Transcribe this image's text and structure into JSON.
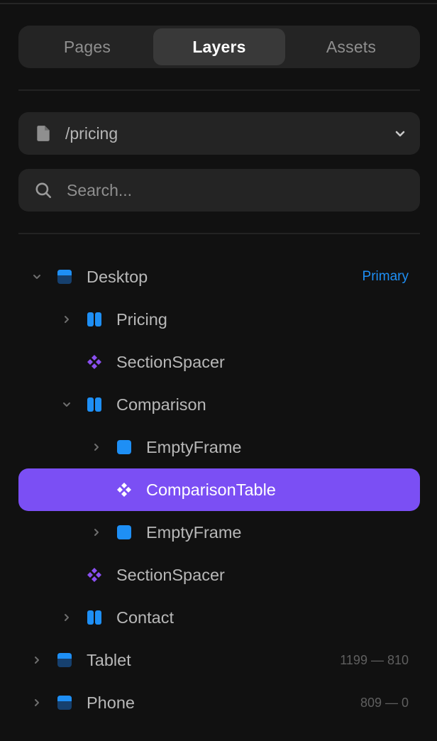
{
  "tabs": [
    {
      "label": "Pages",
      "active": false
    },
    {
      "label": "Layers",
      "active": true
    },
    {
      "label": "Assets",
      "active": false
    }
  ],
  "page_select": {
    "value": "/pricing",
    "icon": "file-icon"
  },
  "search": {
    "placeholder": "Search..."
  },
  "colors": {
    "background": "#111111",
    "selected": "#7b4ff4",
    "primary_tag": "#1e8ff5",
    "frame_icon": "#1e8ff5",
    "component_icon": "#8a4ff0"
  },
  "layers": [
    {
      "label": "Desktop",
      "depth": 0,
      "caret": "expanded",
      "icon": "breakpoint-icon",
      "tag": "Primary"
    },
    {
      "label": "Pricing",
      "depth": 1,
      "caret": "collapsed",
      "icon": "stack-icon"
    },
    {
      "label": "SectionSpacer",
      "depth": 1,
      "caret": "none",
      "icon": "component-icon"
    },
    {
      "label": "Comparison",
      "depth": 1,
      "caret": "expanded",
      "icon": "stack-icon"
    },
    {
      "label": "EmptyFrame",
      "depth": 2,
      "caret": "collapsed",
      "icon": "frame-icon"
    },
    {
      "label": "ComparisonTable",
      "depth": 2,
      "caret": "none",
      "icon": "component-icon",
      "selected": true
    },
    {
      "label": "EmptyFrame",
      "depth": 2,
      "caret": "collapsed",
      "icon": "frame-icon"
    },
    {
      "label": "SectionSpacer",
      "depth": 1,
      "caret": "none",
      "icon": "component-icon"
    },
    {
      "label": "Contact",
      "depth": 1,
      "caret": "collapsed",
      "icon": "stack-icon"
    },
    {
      "label": "Tablet",
      "depth": 0,
      "caret": "collapsed",
      "icon": "breakpoint-icon",
      "range": "1199 — 810"
    },
    {
      "label": "Phone",
      "depth": 0,
      "caret": "collapsed",
      "icon": "breakpoint-icon",
      "range": "809 — 0"
    }
  ]
}
